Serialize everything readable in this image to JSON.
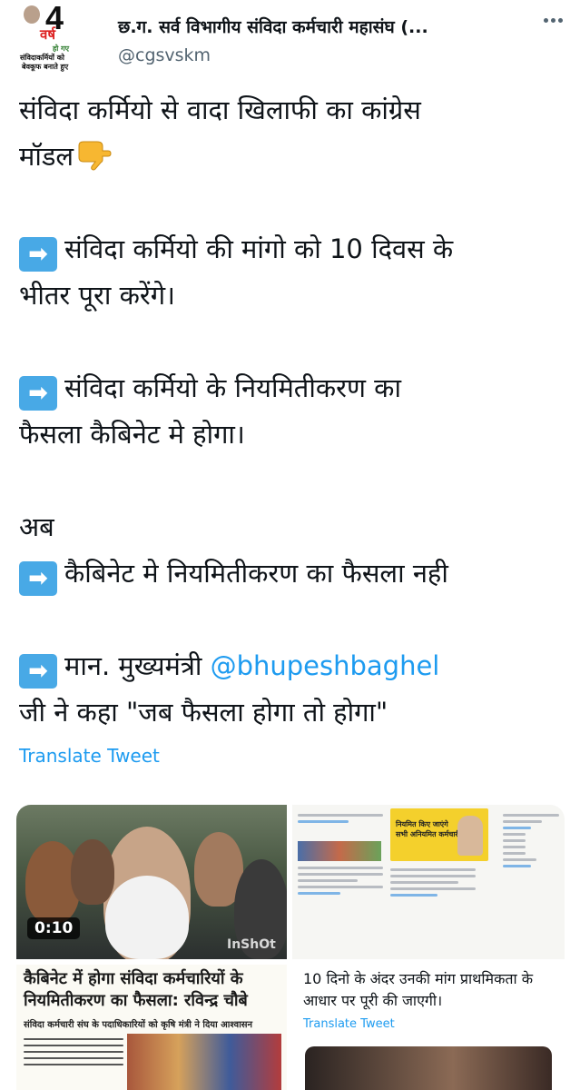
{
  "author": {
    "display_name": "छ.ग. सर्व विभागीय संविदा कर्मचारी महासंघ (...",
    "handle": "@cgsvskm",
    "avatar": {
      "number": "4",
      "red_text": "वर्ष",
      "line1": "हो गए",
      "line2": "संविदाकर्मियों को",
      "line3": "बेवकूफ बनाते हुए"
    }
  },
  "tweet": {
    "line1": "संविदा कर्मियो से वादा खिलाफी का कांग्रेस",
    "line2": "मॉडल",
    "point1_line1": "संविदा कर्मियो की मांगो को 10 दिवस के",
    "point1_line2": "भीतर पूरा करेंगे।",
    "point2_line1": "संविदा कर्मियो के नियमितीकरण का",
    "point2_line2": "फैसला कैबिनेट मे होगा।",
    "now_label": "अब",
    "point3_line1": "कैबिनेट मे नियमितीकरण का फैसला नही",
    "point4_prefix": "मान. मुख्यमंत्री ",
    "point4_mention": "@bhupeshbaghel",
    "point4_line2": "जी ने कहा \"जब फैसला होगा तो होगा\"",
    "arrow_glyph": "➡",
    "translate_label": "Translate Tweet"
  },
  "media": {
    "video_duration": "0:10",
    "video_watermark": "InShOt",
    "tweets_tile": {
      "card_text_1": "नियमित किए जाएंगे",
      "card_text_2": "सभी अनियमित कर्मचारी"
    },
    "news_headline": "कैबिनेट में होगा संविदा कर्मचारियों के नियमितीकरण का फैसला: रविन्द्र चौबे",
    "news_sub": "संविदा कर्मचारी संघ के पदाधिकारियों को कृषि मंत्री ने दिया आश्वासन",
    "screen_text": "10 दिनो के अंदर उनकी मांग प्राथमिकता के आधार पर पूरी की जाएगी।",
    "screen_translate": "Translate Tweet"
  },
  "colors": {
    "link": "#1d9bf0",
    "text": "#0f1419",
    "muted": "#536471",
    "arrow_box": "#48a9e6"
  },
  "icons": [
    "more-icon",
    "right-arrow-icon",
    "backhand-index-pointing-down-icon"
  ]
}
